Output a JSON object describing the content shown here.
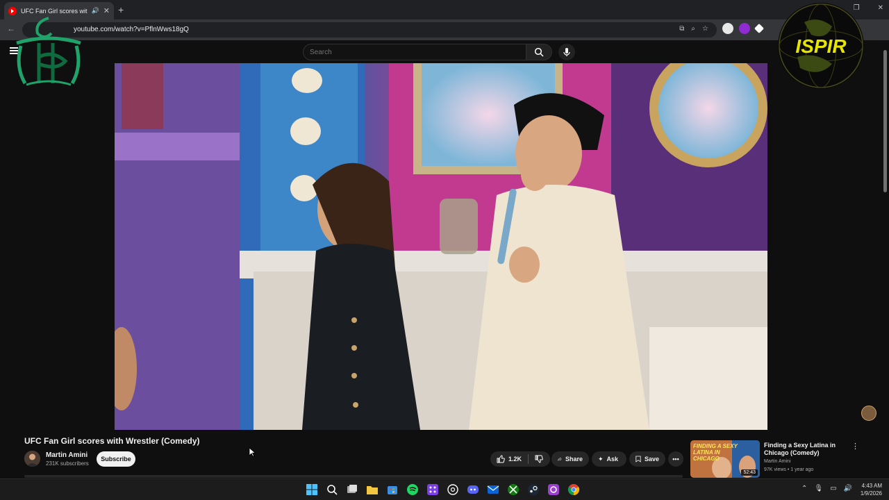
{
  "browser": {
    "tab_title": "UFC Fan Girl scores with Wr",
    "url": "youtube.com/watch?v=PflnWws18gQ"
  },
  "search": {
    "placeholder": "Search"
  },
  "video": {
    "title": "UFC Fan Girl scores with Wrestler (Comedy)",
    "channel": "Martin Amini",
    "subscribers": "231K subscribers",
    "subscribe_label": "Subscribe",
    "like_count": "1.2K",
    "share_label": "Share",
    "ask_label": "Ask",
    "save_label": "Save"
  },
  "recommendation": {
    "thumb_text": "FINDING A SEXY LATINA IN CHICAGO",
    "title": "Finding a Sexy Latina in Chicago (Comedy)",
    "channel": "Martin Amini",
    "meta": "97K views • 1 year ago",
    "duration": "52:43"
  },
  "overlay": {
    "right_logo_text": "ISPIR"
  },
  "taskbar": {
    "time": "4:43 AM",
    "date": "1/9/2026"
  },
  "colors": {
    "youtube_red": "#ff0000",
    "background": "#0f0f0f",
    "logo_green": "#1fa36a",
    "logo_yellow": "#e6e600"
  }
}
